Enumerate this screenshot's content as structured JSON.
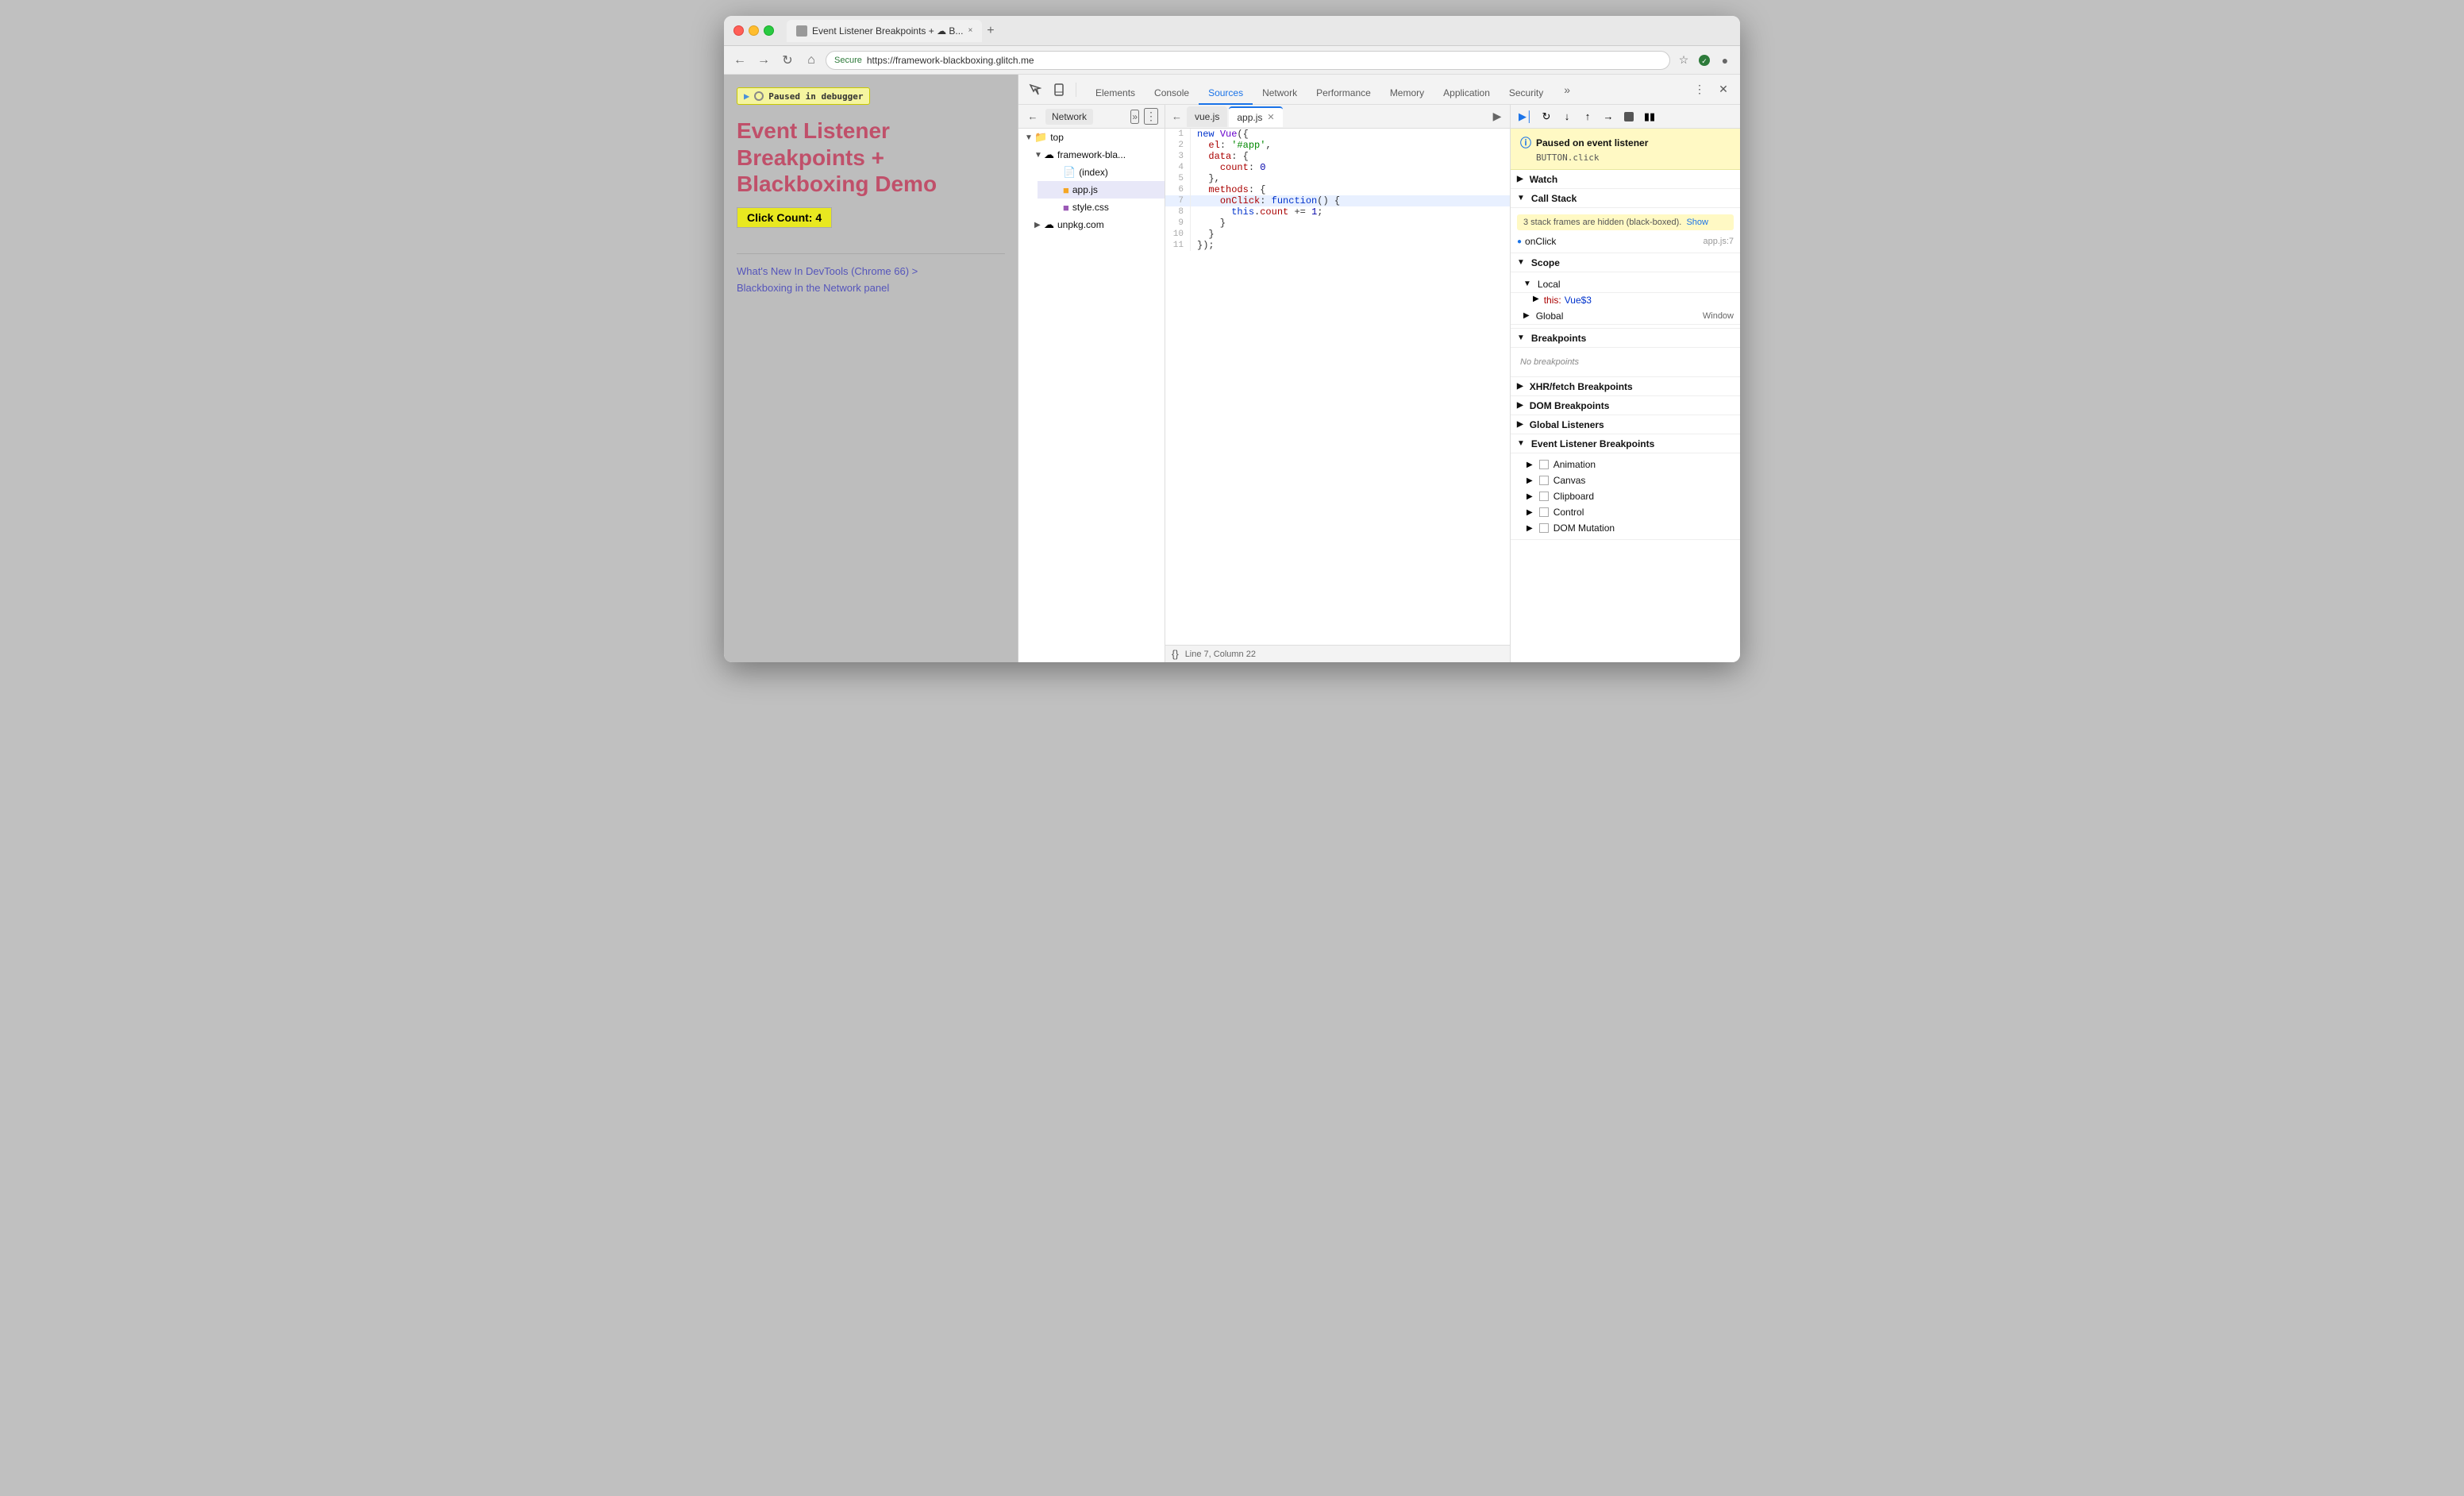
{
  "window": {
    "title": "Event Listener Breakpoints + ☁ Blackboxing Demo",
    "tab_label": "Event Listener Breakpoints + ☁ B...",
    "close_label": "×"
  },
  "addressbar": {
    "secure": "Secure",
    "url": "https://framework-blackboxing.glitch.me"
  },
  "page": {
    "paused_label": "Paused in debugger",
    "title_line1": "Event Listener",
    "title_line2": "Breakpoints +",
    "title_line3": "Blackboxing Demo",
    "click_count": "Click Count: 4",
    "link1": "What's New In DevTools (Chrome 66) >",
    "link2": "Blackboxing in the Network panel"
  },
  "devtools": {
    "tabs": [
      "Elements",
      "Console",
      "Sources",
      "Network",
      "Performance",
      "Memory",
      "Application",
      "Security"
    ],
    "active_tab": "Sources"
  },
  "file_explorer": {
    "network_tab": "Network",
    "root": "top",
    "children": [
      {
        "name": "framework-bla...",
        "type": "domain",
        "children": [
          {
            "name": "(index)",
            "type": "file"
          },
          {
            "name": "app.js",
            "type": "file-js"
          },
          {
            "name": "style.css",
            "type": "file-css"
          }
        ]
      },
      {
        "name": "unpkg.com",
        "type": "domain"
      }
    ]
  },
  "editor": {
    "tabs": [
      {
        "name": "vue.js",
        "active": false
      },
      {
        "name": "app.js",
        "active": true
      }
    ],
    "lines": [
      {
        "num": 1,
        "code": "new Vue({",
        "highlight": false
      },
      {
        "num": 2,
        "code": "  el: '#app',",
        "highlight": false
      },
      {
        "num": 3,
        "code": "  data: {",
        "highlight": false
      },
      {
        "num": 4,
        "code": "    count: 0",
        "highlight": false
      },
      {
        "num": 5,
        "code": "  },",
        "highlight": false
      },
      {
        "num": 6,
        "code": "  methods: {",
        "highlight": false
      },
      {
        "num": 7,
        "code": "    onClick: function() {",
        "highlight": true
      },
      {
        "num": 8,
        "code": "      this.count += 1;",
        "highlight": false
      },
      {
        "num": 9,
        "code": "    }",
        "highlight": false
      },
      {
        "num": 10,
        "code": "  }",
        "highlight": false
      },
      {
        "num": 11,
        "code": "});",
        "highlight": false
      }
    ],
    "statusbar": {
      "format_icon": "{}",
      "position": "Line 7, Column 22"
    }
  },
  "debug": {
    "paused_title": "Paused on event listener",
    "paused_sub": "BUTTON.click",
    "watch_label": "Watch",
    "callstack_label": "Call Stack",
    "callstack_warning": "3 stack frames are hidden (black-boxed).",
    "callstack_show": "Show",
    "onclick_label": "onClick",
    "onclick_loc": "app.js:7",
    "scope_label": "Scope",
    "local_label": "Local",
    "this_label": "this:",
    "this_val": "Vue$3",
    "global_label": "Global",
    "global_val": "Window",
    "breakpoints_label": "Breakpoints",
    "no_breakpoints": "No breakpoints",
    "xhr_label": "XHR/fetch Breakpoints",
    "dom_label": "DOM Breakpoints",
    "global_listeners_label": "Global Listeners",
    "evtbp_label": "Event Listener Breakpoints",
    "evtbp_items": [
      "Animation",
      "Canvas",
      "Clipboard",
      "Control",
      "DOM Mutation"
    ]
  }
}
